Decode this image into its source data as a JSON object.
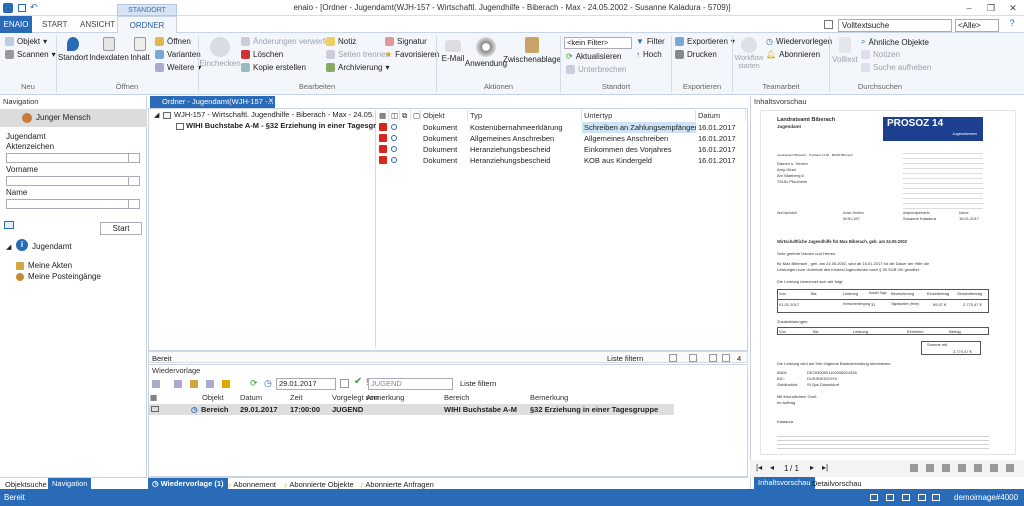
{
  "window": {
    "title": "enaio - [Ordner - Jugendamt(WJH-157 - Wirtschaftl. Jugendhilfe - Biberach - Max - 24.05.2002 - Susanne Kaladura - 5709)]",
    "minimize": "–",
    "maximize": "❐",
    "close": "✕",
    "help": "?"
  },
  "ribbon_tabs": {
    "app": "ENAIO",
    "start": "START",
    "ansicht": "ANSICHT",
    "ordner": "ORDNER",
    "context": "STANDORT"
  },
  "search": {
    "placeholder": "Volltextsuche",
    "scope": "<Alle>"
  },
  "ribbon": {
    "neu": {
      "objekt": "Objekt",
      "scannen": "Scannen",
      "group": "Neu"
    },
    "oeffnen": {
      "standort": "Standort",
      "indexdaten": "Indexdaten",
      "inhalt": "Inhalt",
      "oeffnen": "Öffnen",
      "varianten": "Varianten",
      "weitere": "Weitere",
      "group": "Öffnen"
    },
    "bearbeiten": {
      "einchecken": "Einchecken",
      "aenderungen": "Änderungen verwerfen",
      "loeschen": "Löschen",
      "kopie": "Kopie erstellen",
      "notiz": "Notiz",
      "seiten": "Seiten trennen",
      "archivierung": "Archivierung",
      "signatur": "Signatur",
      "favorisieren": "Favorisieren",
      "group": "Bearbeiten"
    },
    "aktionen": {
      "email": "E-Mail",
      "anwendung": "Anwendung",
      "zwischenablage": "Zwischenablage",
      "group": "Aktionen"
    },
    "standort": {
      "filter_value": "<kein Filter>",
      "filter": "Filter",
      "hoch": "Hoch",
      "aktualisieren": "Aktualisieren",
      "unterbrechen": "Unterbrechen",
      "group": "Standort"
    },
    "exportieren": {
      "exportieren": "Exportieren",
      "drucken": "Drucken",
      "group": "Exportieren"
    },
    "teamarbeit": {
      "workflow": "Workflow starten",
      "wiedervorlegen": "Wiedervorlegen",
      "abonnieren": "Abonnieren",
      "group": "Teamarbeit"
    },
    "durchsuchen": {
      "volltext": "Volltext",
      "aehnliche": "Ähnliche Objekte",
      "notizen": "Notizen",
      "suche_aufheben": "Suche aufheben",
      "group": "Durchsuchen"
    }
  },
  "navigation": {
    "header": "Navigation",
    "selected": "Junger Mensch",
    "fields": [
      "Jugendamt",
      "Aktenzeichen",
      "Vorname",
      "Name"
    ],
    "start": "Start",
    "tree_root": "Jugendamt",
    "tree_items": [
      "Meine Akten",
      "Meine Posteingänge"
    ],
    "tabs": [
      "Objektsuche",
      "Navigation"
    ]
  },
  "folder": {
    "tab": "Ordner - Jugendamt(WJH-157 -...",
    "tree_root": "WJH-157 - Wirtschaftl. Jugendhilfe - Biberach - Max - 24.05.2002 - Susanne Ka",
    "tree_child": "WIHI Buchstabe A-M - §32 Erziehung in einer Tagesgruppe",
    "columns": [
      "Objekt",
      "Typ",
      "Untertyp",
      "Datum"
    ],
    "rows": [
      {
        "objekt": "Dokument",
        "typ": "Kostenübernahmeerklärung",
        "untertyp": "Schreiben an Zahlungsempfänger",
        "datum": "16.01.2017"
      },
      {
        "objekt": "Dokument",
        "typ": "Allgemeines Anschreiben",
        "untertyp": "Allgemeines Anschreiben",
        "datum": "16.01.2017"
      },
      {
        "objekt": "Dokument",
        "typ": "Heranziehungsbescheid",
        "untertyp": "Einkommen des Vorjahres",
        "datum": "16.01.2017"
      },
      {
        "objekt": "Dokument",
        "typ": "Heranziehungsbescheid",
        "untertyp": "KOB aus Kindergeld",
        "datum": "16.01.2017"
      }
    ],
    "status_left": "Bereit",
    "status_right": "Liste filtern",
    "count": "4"
  },
  "wiedervorlage": {
    "header": "Wiedervorlage",
    "date": "29.01.2017",
    "user": "JUGEND",
    "filter": "Liste filtern",
    "columns": [
      "Objekt",
      "Datum",
      "Zeit",
      "Vorgelegt von",
      "Anmerkung",
      "Bereich",
      "Bemerkung"
    ],
    "row": {
      "objekt": "Bereich",
      "datum": "29.01.2017",
      "zeit": "17:00:00",
      "von": "JUGEND",
      "anmerkung": "",
      "bereich": "WIHI Buchstabe A-M",
      "bemerkung": "§32 Erziehung in einer Tagesgruppe"
    },
    "bottom_tabs": [
      "Wiedervorlage (1)",
      "Abonnement",
      "Abonnierte Objekte",
      "Abonnierte Anfragen"
    ]
  },
  "preview": {
    "header": "Inhaltsvorschau",
    "page": "1",
    "of": "/ 1",
    "tabs": [
      "Inhaltsvorschau",
      "Detailvorschau"
    ],
    "doc": {
      "sender": "Landratsamt Biberach",
      "dept": "Jugendamt",
      "logo": "PROSOZ 14",
      "logo_sub": "Jugendwesen",
      "address_line": "Landratsamt Biberach · Postfach 14 60 · 88400 Biberach",
      "recipient": [
        "Damen u. Herren",
        "Amy-Ginal",
        "Am Wartberg 6",
        "75181 Pforzheim"
      ],
      "ref_ihr": "Ihre Nachricht",
      "ref_unser": "Unser Zeichen",
      "ref_ansp": "Ansprechpartner/in",
      "ref_datum": "Datum",
      "ref_val_unser": "WJH-157",
      "ref_val_ansp": "Susanne Kaladura",
      "ref_val_datum": "16.01.2017",
      "subject": "Wirtschaftliche Jugendhilfe für Max Biberach, geb. am 24.05.2002",
      "greeting": "Sehr geehrte Damen und Herren,",
      "body1": "für Max Biberach , geb. am 24.05.2002, wird ab 16.01.2017 für die Dauer der Hilfe die",
      "body2": "Leistungen zum Unterhalt des Kindes/Jugendlichen nach § 39 SGB VIII gewährt.",
      "body3": "Die Leistung berechnet sich wie folgt:",
      "t1_head": [
        "Von",
        "Bis",
        "Leistung",
        "Anzahl Tage",
        "Bezeichnung",
        "Einzelbetrag",
        "Gesamtbetrag"
      ],
      "t1_row": [
        "01.01.2017",
        "",
        "Heimunterbringung",
        "31",
        "Tageskosten (Heim)",
        "89,37 €",
        "2.770,47 €"
      ],
      "zusatz": "Zusatzleistungen:",
      "t2_head": [
        "Von",
        "Bis",
        "Leistung",
        "Einheiten",
        "Betrag"
      ],
      "summe_label": "Summe mtl.",
      "summe": "2.770,47 €",
      "bank_intro": "Die Leistung wird auf Ihre folgende Bankverbindung überwiesen:",
      "iban_l": "IBAN:",
      "iban": "DE29300501100006924328",
      "bic_l": "BIC:",
      "bic": "DUSSDEDDXXX",
      "gi_l": "Geldinstitut:",
      "gi": "St Spk Düsseldorf",
      "gruss": "Mit freundlichem Gruß",
      "iA": "Im Auftrag",
      "sign": "Kaladura"
    }
  },
  "statusbar": {
    "left": "Bereit",
    "right": "demoimage#4000"
  },
  "colors": {
    "accent": "#2a6bb8",
    "pdf": "#d9261c",
    "selection": "#cfe3f7"
  }
}
